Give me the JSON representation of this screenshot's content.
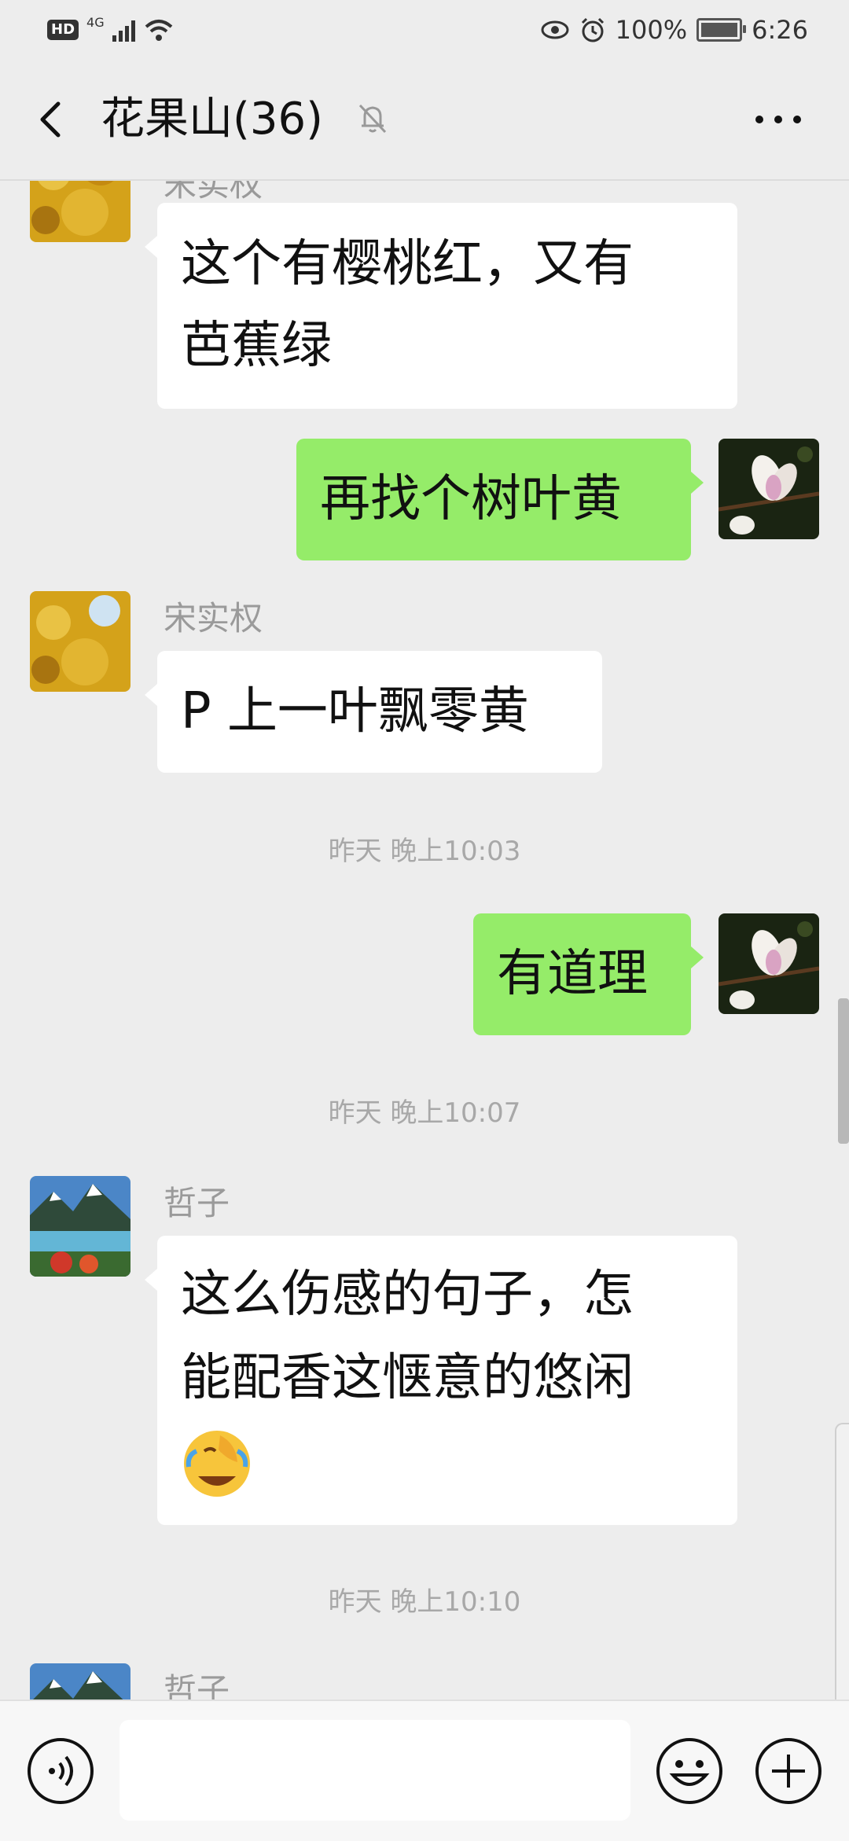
{
  "status_bar": {
    "hd_label": "HD",
    "network": "4G",
    "battery_text": "100%",
    "time": "6:26"
  },
  "title_bar": {
    "title": "花果山(36)"
  },
  "messages": [
    {
      "type": "received",
      "sender": "宋实权",
      "text_line1": "这个有樱桃红，又有",
      "text_line2": "芭蕉绿"
    },
    {
      "type": "sent",
      "text": "再找个树叶黄"
    },
    {
      "type": "received",
      "sender": "宋实权",
      "text": "P 上一叶飘零黄"
    },
    {
      "type": "time",
      "text": "昨天 晚上10:03"
    },
    {
      "type": "sent",
      "text": "有道理"
    },
    {
      "type": "time",
      "text": "昨天 晚上10:07"
    },
    {
      "type": "received",
      "sender": "哲子",
      "text_line1": "这么伤感的句子，怎",
      "text_line2": "能配香这惬意的悠闲",
      "emoji": "facepalm-laughing-emoji"
    },
    {
      "type": "time",
      "text": "昨天 晚上10:10"
    },
    {
      "type": "received",
      "sender": "哲子"
    }
  ],
  "input_bar": {
    "value": "",
    "icons": [
      "voice-icon",
      "emoji-icon",
      "plus-icon"
    ]
  },
  "colors": {
    "background": "#ededed",
    "sent_bubble": "#95ec69",
    "received_bubble": "#ffffff",
    "timestamp": "#a8a8a8"
  }
}
